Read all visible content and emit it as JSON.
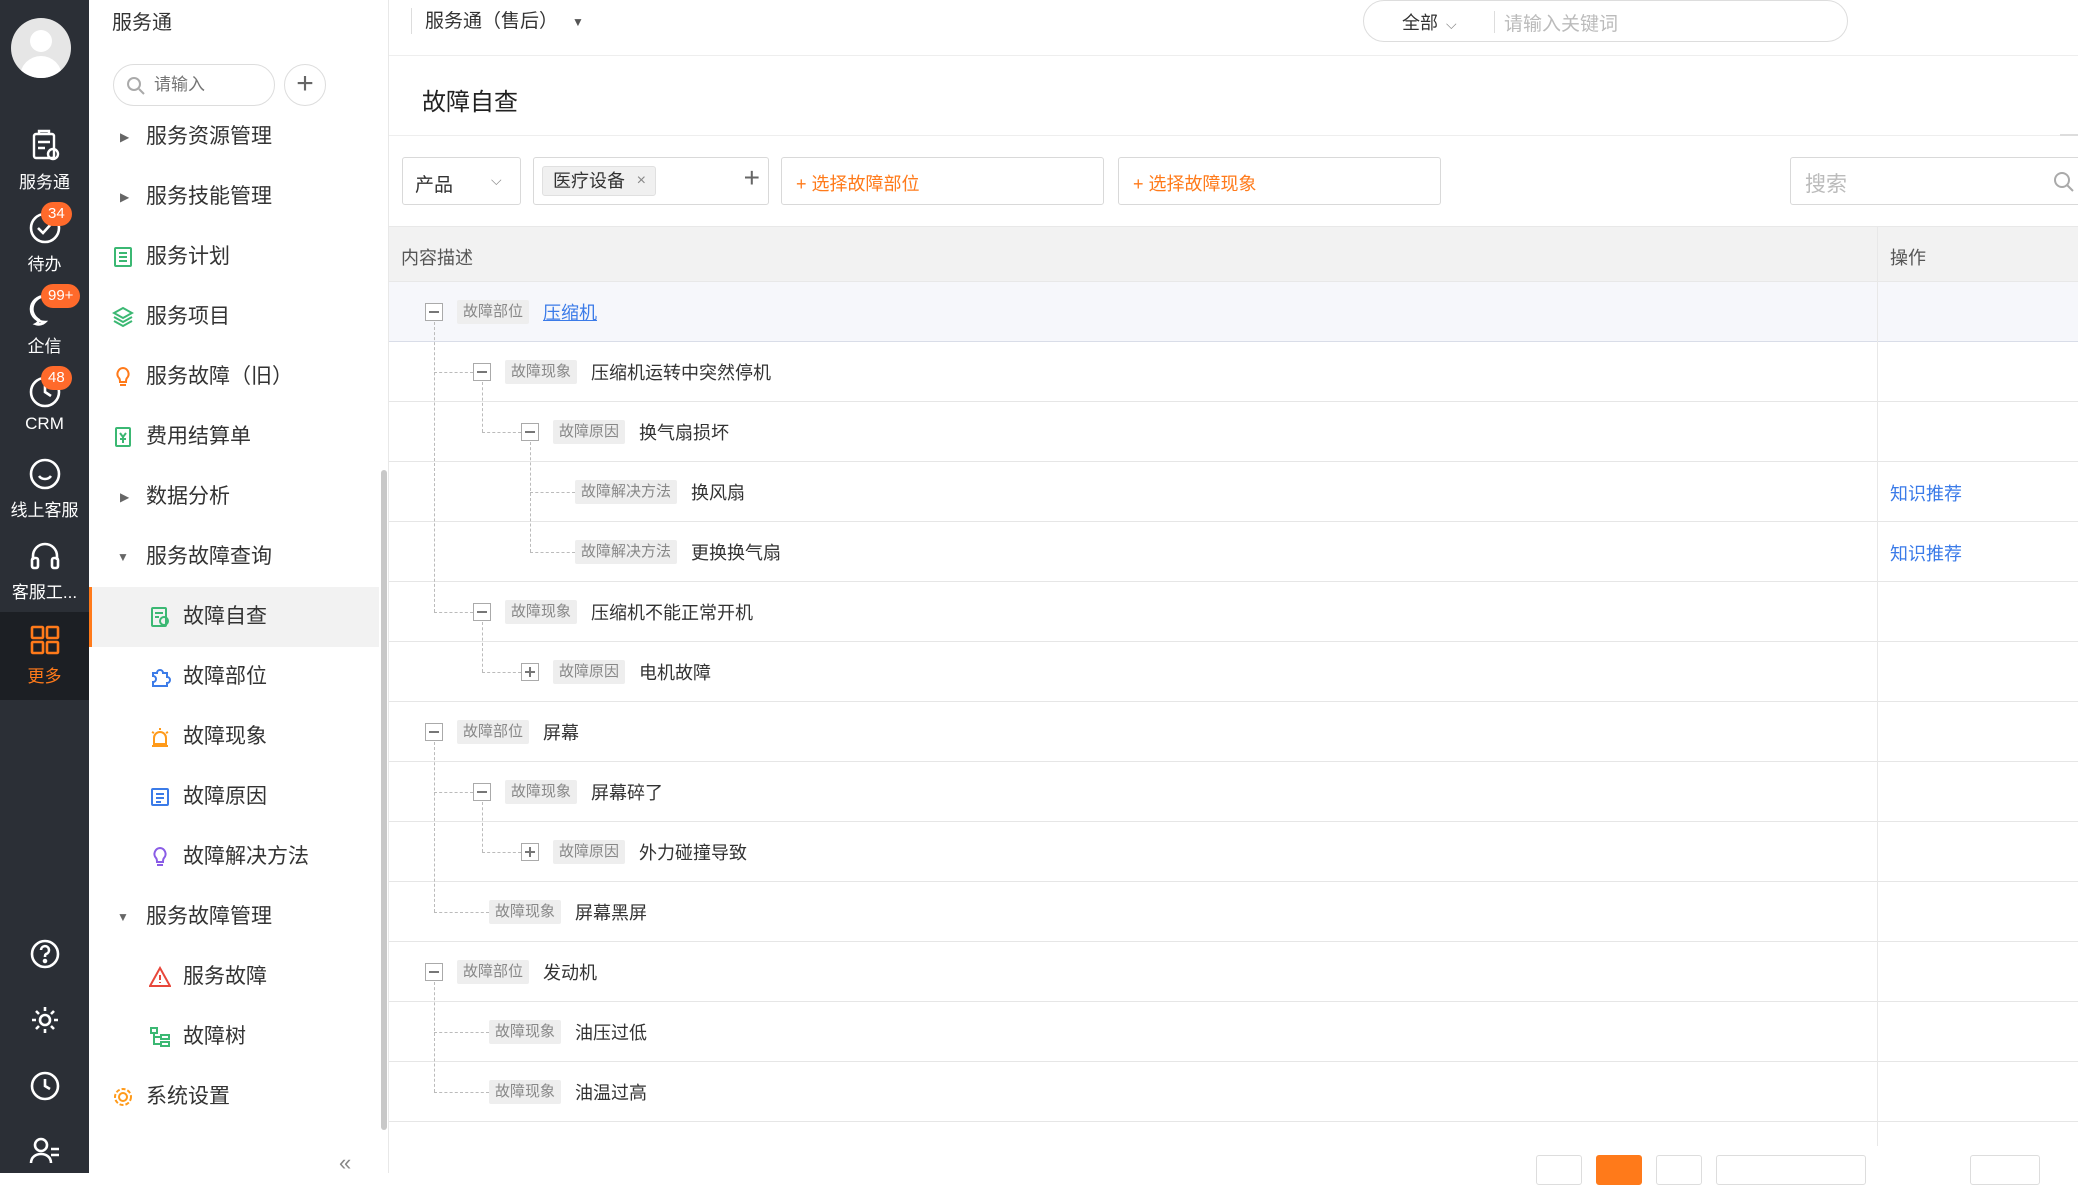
{
  "rail": {
    "items": [
      {
        "label": "服务通",
        "badge": ""
      },
      {
        "label": "待办",
        "badge": "34"
      },
      {
        "label": "企信",
        "badge": "99+"
      },
      {
        "label": "CRM",
        "badge": "48"
      },
      {
        "label": "线上客服",
        "badge": ""
      },
      {
        "label": "客服工...",
        "badge": ""
      },
      {
        "label": "更多",
        "badge": ""
      }
    ],
    "accent": "#ff7a1a"
  },
  "sidebar": {
    "app_title": "服务通",
    "search_placeholder": "请输入",
    "items": {
      "resource": "服务资源管理",
      "skill": "服务技能管理",
      "plan": "服务计划",
      "project": "服务项目",
      "fault_old": "服务故障（旧）",
      "bill": "费用结算单",
      "analysis": "数据分析",
      "query": "服务故障查询",
      "self_check": "故障自查",
      "part": "故障部位",
      "phenomenon": "故障现象",
      "cause": "故障原因",
      "solution": "故障解决方法",
      "manage": "服务故障管理",
      "service_fault": "服务故障",
      "fault_tree": "故障树",
      "settings": "系统设置"
    }
  },
  "topbar": {
    "workspace": "服务通（售后）",
    "scope": "全部",
    "keyword_placeholder": "请输入关键词"
  },
  "page": {
    "title": "故障自查",
    "filters": {
      "product_label": "产品",
      "device_tag": "医疗设备",
      "select_part": "+ 选择故障部位",
      "select_phenomenon": "+ 选择故障现象",
      "search_placeholder": "搜索"
    },
    "table": {
      "col_desc": "内容描述",
      "col_op": "操作",
      "rows": [
        {
          "tag": "故障部位",
          "text": "压缩机",
          "op": ""
        },
        {
          "tag": "故障现象",
          "text": "压缩机运转中突然停机",
          "op": ""
        },
        {
          "tag": "故障原因",
          "text": "换气扇损坏",
          "op": ""
        },
        {
          "tag": "故障解决方法",
          "text": "换风扇",
          "op": "知识推荐"
        },
        {
          "tag": "故障解决方法",
          "text": "更换换气扇",
          "op": "知识推荐"
        },
        {
          "tag": "故障现象",
          "text": "压缩机不能正常开机",
          "op": ""
        },
        {
          "tag": "故障原因",
          "text": "电机故障",
          "op": ""
        },
        {
          "tag": "故障部位",
          "text": "屏幕",
          "op": ""
        },
        {
          "tag": "故障现象",
          "text": "屏幕碎了",
          "op": ""
        },
        {
          "tag": "故障原因",
          "text": "外力碰撞导致",
          "op": ""
        },
        {
          "tag": "故障现象",
          "text": "屏幕黑屏",
          "op": ""
        },
        {
          "tag": "故障部位",
          "text": "发动机",
          "op": ""
        },
        {
          "tag": "故障现象",
          "text": "油压过低",
          "op": ""
        },
        {
          "tag": "故障现象",
          "text": "油温过高",
          "op": ""
        }
      ]
    }
  }
}
